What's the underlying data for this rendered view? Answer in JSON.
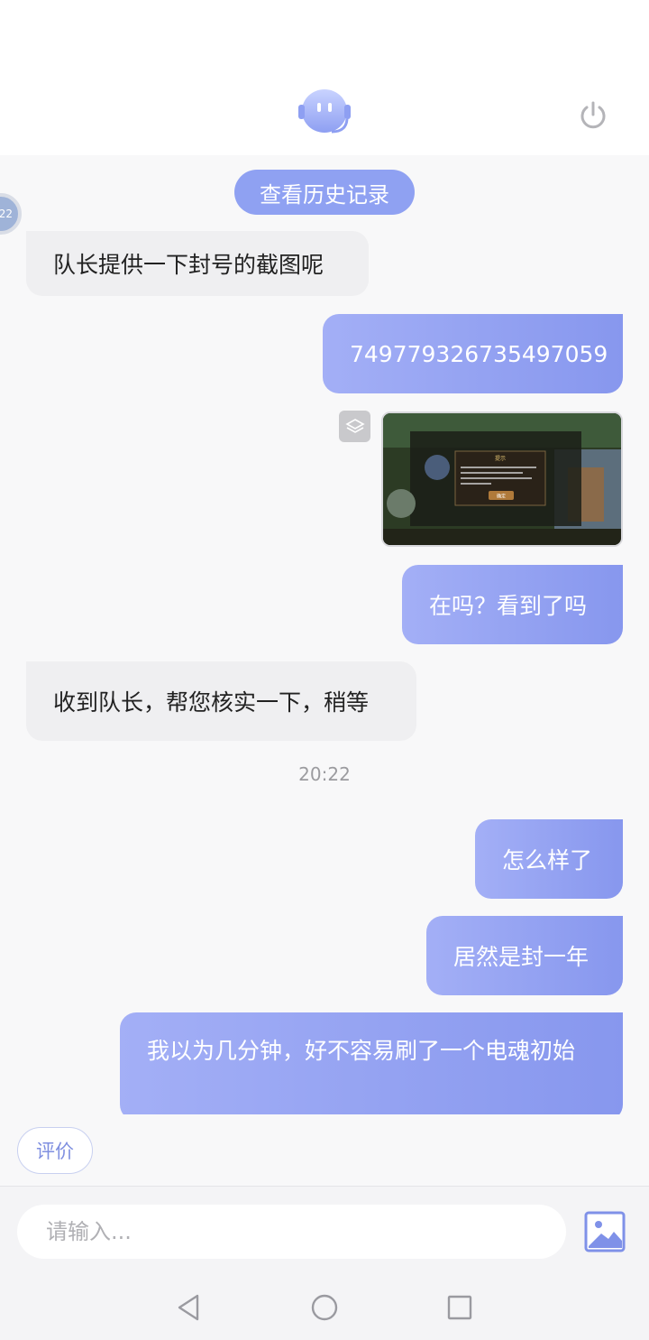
{
  "header": {
    "logo_icon": "robot-headset-icon",
    "power_icon": "power-icon"
  },
  "chat": {
    "history_button": "查看历史记录",
    "agent_avatar_text": "22",
    "messages": [
      {
        "from": "agent",
        "text": "队长提供一下封号的截图呢"
      },
      {
        "from": "user",
        "text": "749779326735497059"
      },
      {
        "from": "user",
        "type": "image",
        "dialog_title": "提示",
        "dialog_button": "确定"
      },
      {
        "from": "user",
        "text": "在吗？看到了吗"
      },
      {
        "from": "agent",
        "text": "收到队长，帮您核实一下，稍等"
      },
      {
        "from": "user",
        "text": "怎么样了"
      },
      {
        "from": "user",
        "text": "居然是封一年"
      },
      {
        "from": "user",
        "text": "我以为几分钟，好不容易刷了一个电魂初始"
      }
    ],
    "timestamp": "20:22"
  },
  "rate_button": "评价",
  "input": {
    "placeholder": "请输入...",
    "value": ""
  },
  "navbar": {
    "back_icon": "back-triangle-icon",
    "home_icon": "home-circle-icon",
    "recent_icon": "recent-square-icon"
  },
  "colors": {
    "accent": "#8fa1f2",
    "bubble_gradient_start": "#a3aff6",
    "bubble_gradient_end": "#8797ee"
  }
}
